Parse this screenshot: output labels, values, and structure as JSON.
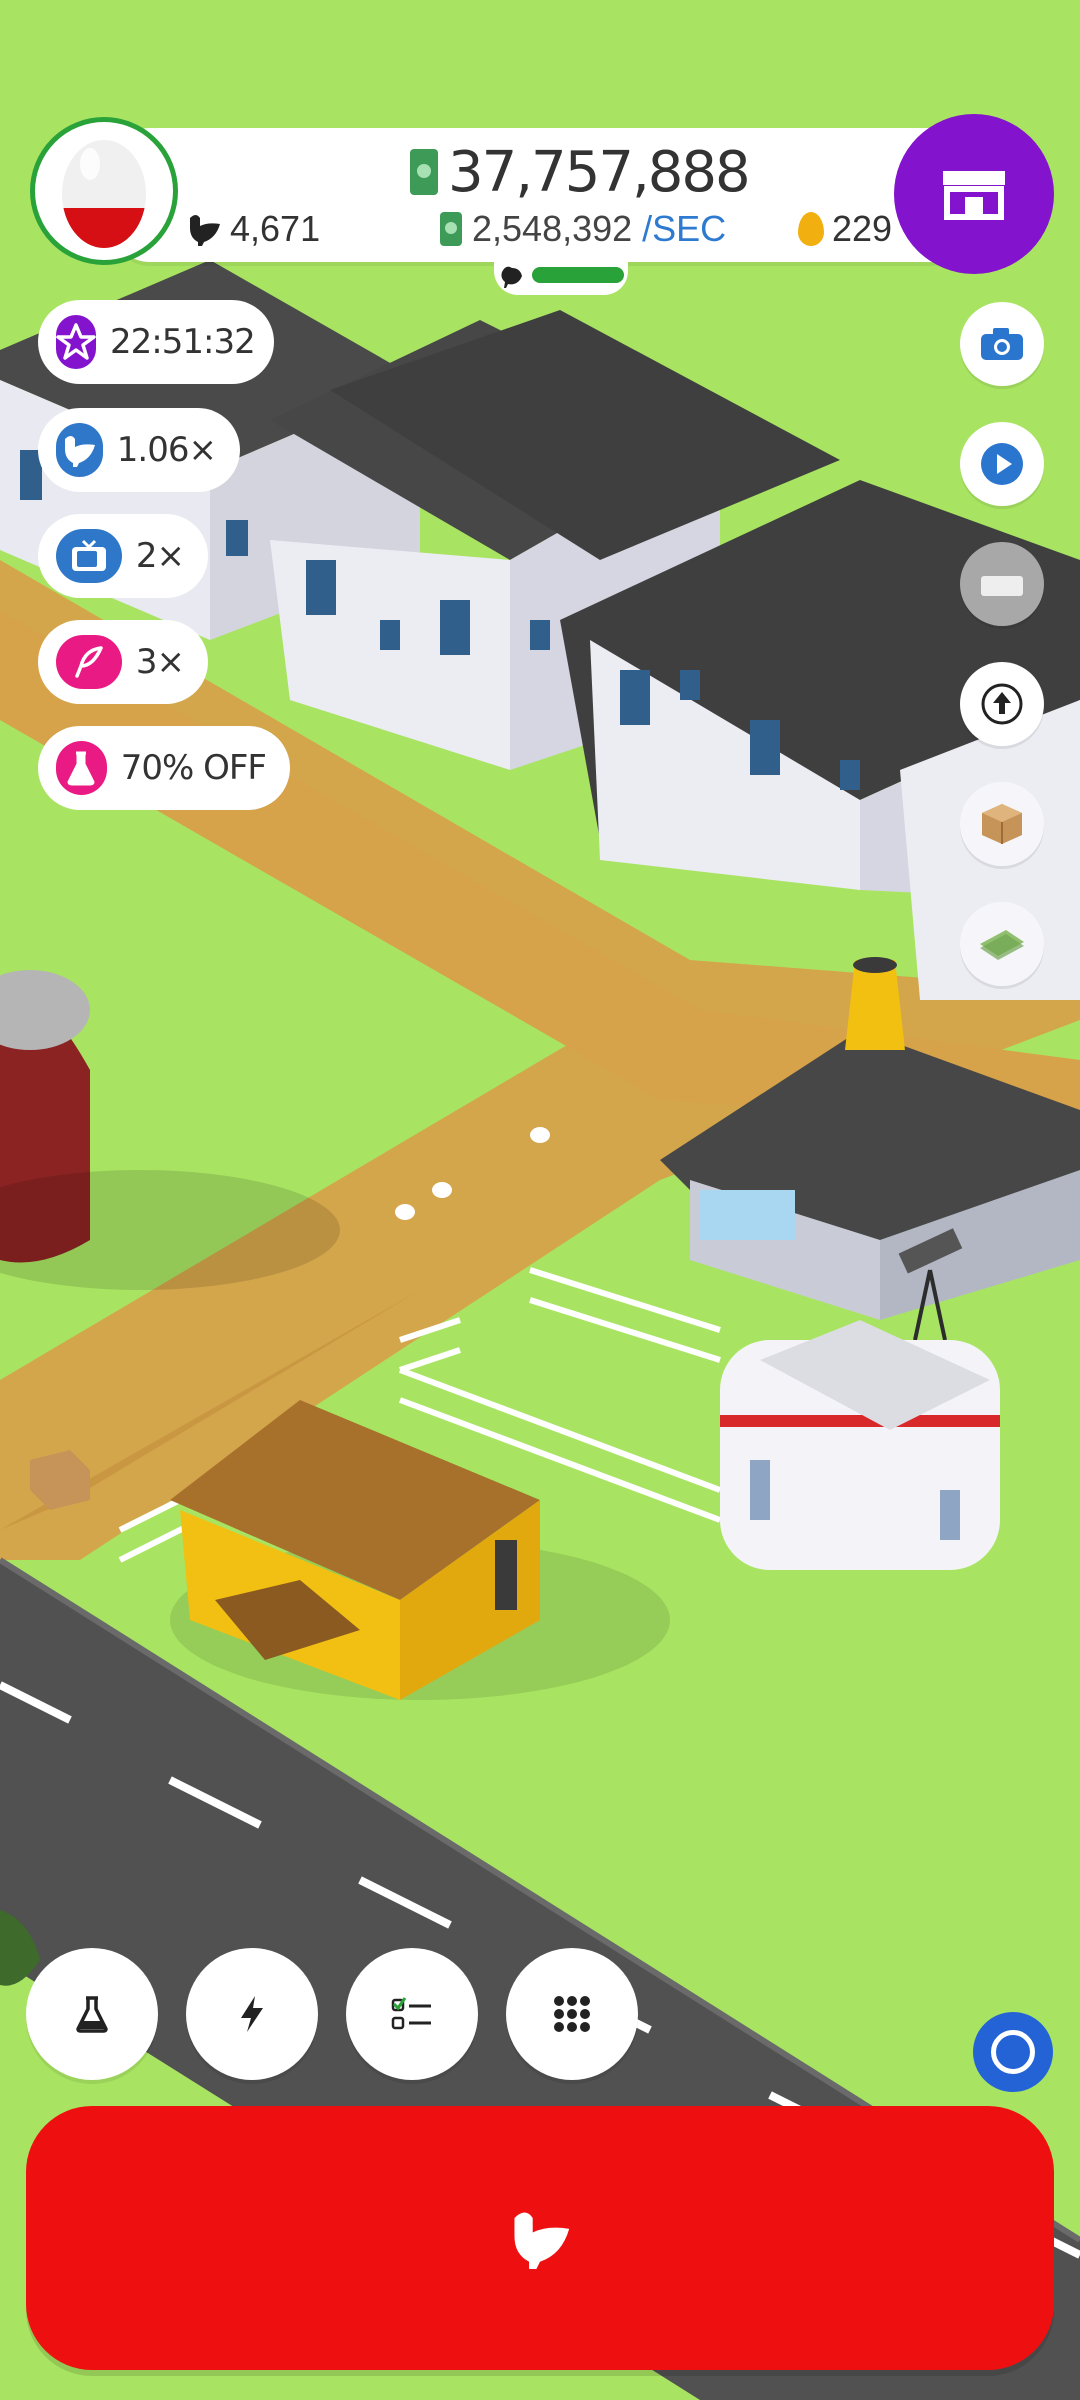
{
  "colors": {
    "grass": "#a8e462",
    "road": "#515151",
    "dirt_path": "#d6a24a",
    "accent_purple": "#8313cc",
    "hatch_red": "#ee1010",
    "progress_green": "#2aa23a"
  },
  "header": {
    "money": "37,757,888",
    "rate_value": "2,548,392",
    "rate_unit": "/SEC",
    "chicken_count": "4,671",
    "golden_eggs": "229",
    "hatchery_fill": 1.0,
    "shop_icon": "store-icon"
  },
  "boosts": [
    {
      "text": "22:51:32",
      "icon": "star-icon",
      "color": "#8313cc"
    },
    {
      "text": "1.06×",
      "icon": "chicken-icon",
      "color": "#2f78c9"
    },
    {
      "text": "2×",
      "icon": "tv-icon",
      "color": "#2f78c9"
    },
    {
      "text": "3×",
      "icon": "feather-icon",
      "color": "#ea1a84"
    },
    {
      "text": "70% OFF",
      "icon": "flask-icon",
      "color": "#ea1a84"
    }
  ],
  "side_buttons": [
    "camera-icon",
    "play-video-icon",
    "cash-stack-icon",
    "upload-arrow-icon",
    "package-icon",
    "banknote-icon"
  ],
  "bottom_buttons": [
    "research-flask-icon",
    "boost-lightning-icon",
    "missions-checklist-icon",
    "menu-grid-icon"
  ],
  "hatch_button": {
    "icon": "chicken-icon"
  }
}
